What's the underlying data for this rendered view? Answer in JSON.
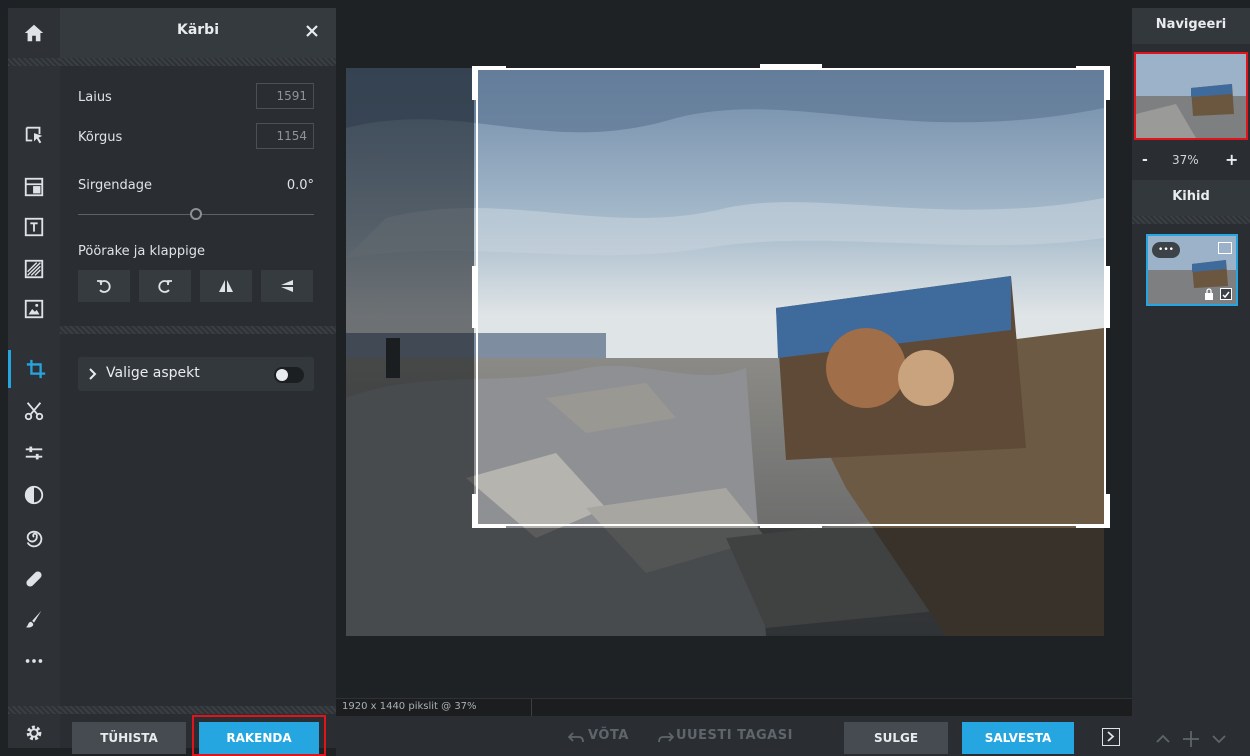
{
  "toolbar": {
    "tools": [
      "home-icon",
      "select-icon",
      "layers-panel-icon",
      "text-icon",
      "pattern-icon",
      "image-icon",
      "crop-icon",
      "cut-icon",
      "adjust-icon",
      "filter-icon",
      "swirl-icon",
      "heal-icon",
      "brush-icon",
      "more-icon",
      "settings-icon"
    ],
    "active": "crop-icon",
    "accent": "#26a6e0"
  },
  "panel": {
    "title": "Kärbi",
    "width_label": "Laius",
    "width_value": "1591",
    "height_label": "Kõrgus",
    "height_value": "1154",
    "straighten_label": "Sirgendage",
    "straighten_value": "0.0°",
    "rotate_label": "Pöörake ja klappige",
    "aspect_label": "Valige aspekt",
    "cancel_label": "TÜHISTA",
    "apply_label": "RAKENDA"
  },
  "canvas": {
    "status": "1920 x 1440 pikslit @ 37%"
  },
  "bottom": {
    "undo_label": "VÕTA",
    "redo_label": "UUESTI TAGASI",
    "close_label": "SULGE",
    "save_label": "SALVESTA"
  },
  "right": {
    "navigator_title": "Navigeeri",
    "zoom_minus": "-",
    "zoom_value": "37%",
    "zoom_plus": "+",
    "layers_title": "Kihid",
    "layer_more": "•••"
  },
  "colors": {
    "accent": "#26a6e0",
    "highlight_box": "#e0141a"
  }
}
